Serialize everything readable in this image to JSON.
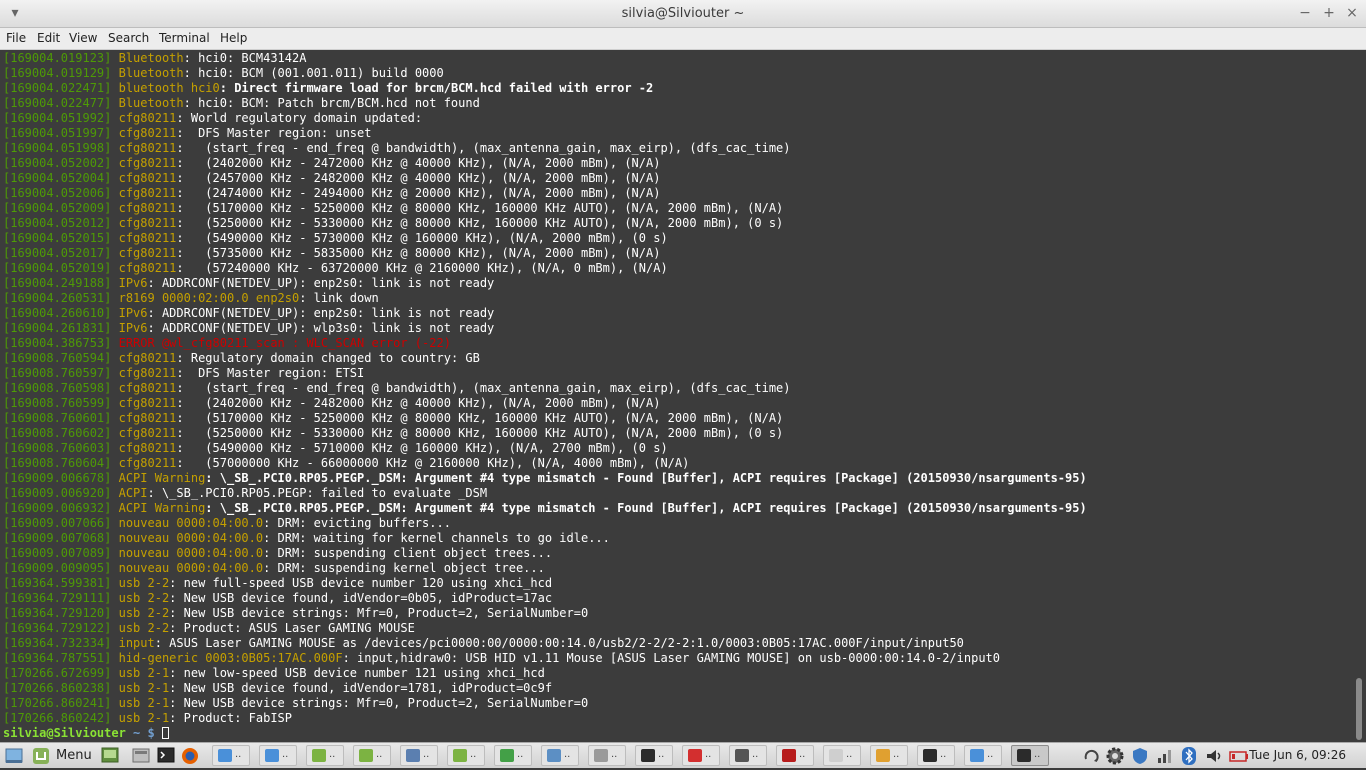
{
  "window": {
    "title": "silvia@Silviouter ~",
    "controls": {
      "minimize": "−",
      "maximize": "+",
      "close": "×"
    }
  },
  "menu": [
    "File",
    "Edit",
    "View",
    "Search",
    "Terminal",
    "Help"
  ],
  "terminal": {
    "lines": [
      {
        "ts": "[169004.019123]",
        "sub": "Bluetooth",
        "msg": ": hci0: BCM43142A"
      },
      {
        "ts": "[169004.019129]",
        "sub": "Bluetooth",
        "msg": ": hci0: BCM (001.001.011) build 0000"
      },
      {
        "ts": "[169004.022471]",
        "sub": "bluetooth hci0",
        "msg": ": Direct firmware load for brcm/BCM.hcd failed with error -2",
        "bold": true
      },
      {
        "ts": "[169004.022477]",
        "sub": "Bluetooth",
        "msg": ": hci0: BCM: Patch brcm/BCM.hcd not found"
      },
      {
        "ts": "[169004.051992]",
        "sub": "cfg80211",
        "msg": ": World regulatory domain updated:"
      },
      {
        "ts": "[169004.051997]",
        "sub": "cfg80211",
        "msg": ":  DFS Master region: unset"
      },
      {
        "ts": "[169004.051998]",
        "sub": "cfg80211",
        "msg": ":   (start_freq - end_freq @ bandwidth), (max_antenna_gain, max_eirp), (dfs_cac_time)"
      },
      {
        "ts": "[169004.052002]",
        "sub": "cfg80211",
        "msg": ":   (2402000 KHz - 2472000 KHz @ 40000 KHz), (N/A, 2000 mBm), (N/A)"
      },
      {
        "ts": "[169004.052004]",
        "sub": "cfg80211",
        "msg": ":   (2457000 KHz - 2482000 KHz @ 40000 KHz), (N/A, 2000 mBm), (N/A)"
      },
      {
        "ts": "[169004.052006]",
        "sub": "cfg80211",
        "msg": ":   (2474000 KHz - 2494000 KHz @ 20000 KHz), (N/A, 2000 mBm), (N/A)"
      },
      {
        "ts": "[169004.052009]",
        "sub": "cfg80211",
        "msg": ":   (5170000 KHz - 5250000 KHz @ 80000 KHz, 160000 KHz AUTO), (N/A, 2000 mBm), (N/A)"
      },
      {
        "ts": "[169004.052012]",
        "sub": "cfg80211",
        "msg": ":   (5250000 KHz - 5330000 KHz @ 80000 KHz, 160000 KHz AUTO), (N/A, 2000 mBm), (0 s)"
      },
      {
        "ts": "[169004.052015]",
        "sub": "cfg80211",
        "msg": ":   (5490000 KHz - 5730000 KHz @ 160000 KHz), (N/A, 2000 mBm), (0 s)"
      },
      {
        "ts": "[169004.052017]",
        "sub": "cfg80211",
        "msg": ":   (5735000 KHz - 5835000 KHz @ 80000 KHz), (N/A, 2000 mBm), (N/A)"
      },
      {
        "ts": "[169004.052019]",
        "sub": "cfg80211",
        "msg": ":   (57240000 KHz - 63720000 KHz @ 2160000 KHz), (N/A, 0 mBm), (N/A)"
      },
      {
        "ts": "[169004.249188]",
        "sub": "IPv6",
        "msg": ": ADDRCONF(NETDEV_UP): enp2s0: link is not ready"
      },
      {
        "ts": "[169004.260531]",
        "sub": "r8169 0000:02:00.0 enp2s0",
        "msg": ": link down"
      },
      {
        "ts": "[169004.260610]",
        "sub": "IPv6",
        "msg": ": ADDRCONF(NETDEV_UP): enp2s0: link is not ready"
      },
      {
        "ts": "[169004.261831]",
        "sub": "IPv6",
        "msg": ": ADDRCONF(NETDEV_UP): wlp3s0: link is not ready"
      },
      {
        "ts": "[169004.386753]",
        "sub": "ERROR @wl_cfg80211_scan : WLC_SCAN error (-22)",
        "msg": "",
        "error": true
      },
      {
        "ts": "[169008.760594]",
        "sub": "cfg80211",
        "msg": ": Regulatory domain changed to country: GB"
      },
      {
        "ts": "[169008.760597]",
        "sub": "cfg80211",
        "msg": ":  DFS Master region: ETSI"
      },
      {
        "ts": "[169008.760598]",
        "sub": "cfg80211",
        "msg": ":   (start_freq - end_freq @ bandwidth), (max_antenna_gain, max_eirp), (dfs_cac_time)"
      },
      {
        "ts": "[169008.760599]",
        "sub": "cfg80211",
        "msg": ":   (2402000 KHz - 2482000 KHz @ 40000 KHz), (N/A, 2000 mBm), (N/A)"
      },
      {
        "ts": "[169008.760601]",
        "sub": "cfg80211",
        "msg": ":   (5170000 KHz - 5250000 KHz @ 80000 KHz, 160000 KHz AUTO), (N/A, 2000 mBm), (N/A)"
      },
      {
        "ts": "[169008.760602]",
        "sub": "cfg80211",
        "msg": ":   (5250000 KHz - 5330000 KHz @ 80000 KHz, 160000 KHz AUTO), (N/A, 2000 mBm), (0 s)"
      },
      {
        "ts": "[169008.760603]",
        "sub": "cfg80211",
        "msg": ":   (5490000 KHz - 5710000 KHz @ 160000 KHz), (N/A, 2700 mBm), (0 s)"
      },
      {
        "ts": "[169008.760604]",
        "sub": "cfg80211",
        "msg": ":   (57000000 KHz - 66000000 KHz @ 2160000 KHz), (N/A, 4000 mBm), (N/A)"
      },
      {
        "ts": "[169009.006678]",
        "sub": "ACPI Warning",
        "msg": ": \\_SB_.PCI0.RP05.PEGP._DSM: Argument #4 type mismatch - Found [Buffer], ACPI requires [Package] (20150930/nsarguments-95)",
        "bold": true
      },
      {
        "ts": "[169009.006920]",
        "sub": "ACPI",
        "msg": ": \\_SB_.PCI0.RP05.PEGP: failed to evaluate _DSM"
      },
      {
        "ts": "[169009.006932]",
        "sub": "ACPI Warning",
        "msg": ": \\_SB_.PCI0.RP05.PEGP._DSM: Argument #4 type mismatch - Found [Buffer], ACPI requires [Package] (20150930/nsarguments-95)",
        "bold": true
      },
      {
        "ts": "[169009.007066]",
        "sub": "nouveau 0000:04:00.0",
        "msg": ": DRM: evicting buffers..."
      },
      {
        "ts": "[169009.007068]",
        "sub": "nouveau 0000:04:00.0",
        "msg": ": DRM: waiting for kernel channels to go idle..."
      },
      {
        "ts": "[169009.007089]",
        "sub": "nouveau 0000:04:00.0",
        "msg": ": DRM: suspending client object trees..."
      },
      {
        "ts": "[169009.009095]",
        "sub": "nouveau 0000:04:00.0",
        "msg": ": DRM: suspending kernel object tree..."
      },
      {
        "ts": "[169364.599381]",
        "sub": "usb 2-2",
        "msg": ": new full-speed USB device number 120 using xhci_hcd"
      },
      {
        "ts": "[169364.729111]",
        "sub": "usb 2-2",
        "msg": ": New USB device found, idVendor=0b05, idProduct=17ac"
      },
      {
        "ts": "[169364.729120]",
        "sub": "usb 2-2",
        "msg": ": New USB device strings: Mfr=0, Product=2, SerialNumber=0"
      },
      {
        "ts": "[169364.729122]",
        "sub": "usb 2-2",
        "msg": ": Product: ASUS Laser GAMING MOUSE"
      },
      {
        "ts": "[169364.732334]",
        "sub": "input",
        "msg": ": ASUS Laser GAMING MOUSE as /devices/pci0000:00/0000:00:14.0/usb2/2-2/2-2:1.0/0003:0B05:17AC.000F/input/input50"
      },
      {
        "ts": "[169364.787551]",
        "sub": "hid-generic 0003:0B05:17AC.000F",
        "msg": ": input,hidraw0: USB HID v1.11 Mouse [ASUS Laser GAMING MOUSE] on usb-0000:00:14.0-2/input0"
      },
      {
        "ts": "[170266.672699]",
        "sub": "usb 2-1",
        "msg": ": new low-speed USB device number 121 using xhci_hcd"
      },
      {
        "ts": "[170266.860238]",
        "sub": "usb 2-1",
        "msg": ": New USB device found, idVendor=1781, idProduct=0c9f"
      },
      {
        "ts": "[170266.860241]",
        "sub": "usb 2-1",
        "msg": ": New USB device strings: Mfr=0, Product=2, SerialNumber=0"
      },
      {
        "ts": "[170266.860242]",
        "sub": "usb 2-1",
        "msg": ": Product: FabISP"
      }
    ],
    "prompt": {
      "user": "silvia@Silviouter",
      "path": " ~ ",
      "symbol": "$ "
    }
  },
  "taskbar": {
    "menu_label": "Menu",
    "tasks": [
      {
        "icon": "browser-icon",
        "color": "#4a90d9"
      },
      {
        "icon": "browser-icon",
        "color": "#4a90d9"
      },
      {
        "icon": "folder-icon",
        "color": "#7cb342"
      },
      {
        "icon": "folder-icon",
        "color": "#7cb342"
      },
      {
        "icon": "window-icon",
        "color": "#5b7fb0"
      },
      {
        "icon": "folder-icon",
        "color": "#7cb342"
      },
      {
        "icon": "chat-icon",
        "color": "#43a047"
      },
      {
        "icon": "image-viewer-icon",
        "color": "#5c8fc4"
      },
      {
        "icon": "window-icon",
        "color": "#9a9a9a"
      },
      {
        "icon": "terminal-icon",
        "color": "#2b2b2b"
      },
      {
        "icon": "pdf-icon",
        "color": "#d32f2f"
      },
      {
        "icon": "text-editor-icon",
        "color": "#555555"
      },
      {
        "icon": "presentation-icon",
        "color": "#b71c1c"
      },
      {
        "icon": "document-icon",
        "color": "#cfcfcf"
      },
      {
        "icon": "notes-icon",
        "color": "#e0a030"
      },
      {
        "icon": "terminal-icon",
        "color": "#2b2b2b"
      },
      {
        "icon": "browser-icon",
        "color": "#4a90d9"
      },
      {
        "icon": "terminal-icon",
        "color": "#2b2b2b",
        "active": true
      }
    ],
    "clock": "Tue Jun 6, 09:26"
  }
}
